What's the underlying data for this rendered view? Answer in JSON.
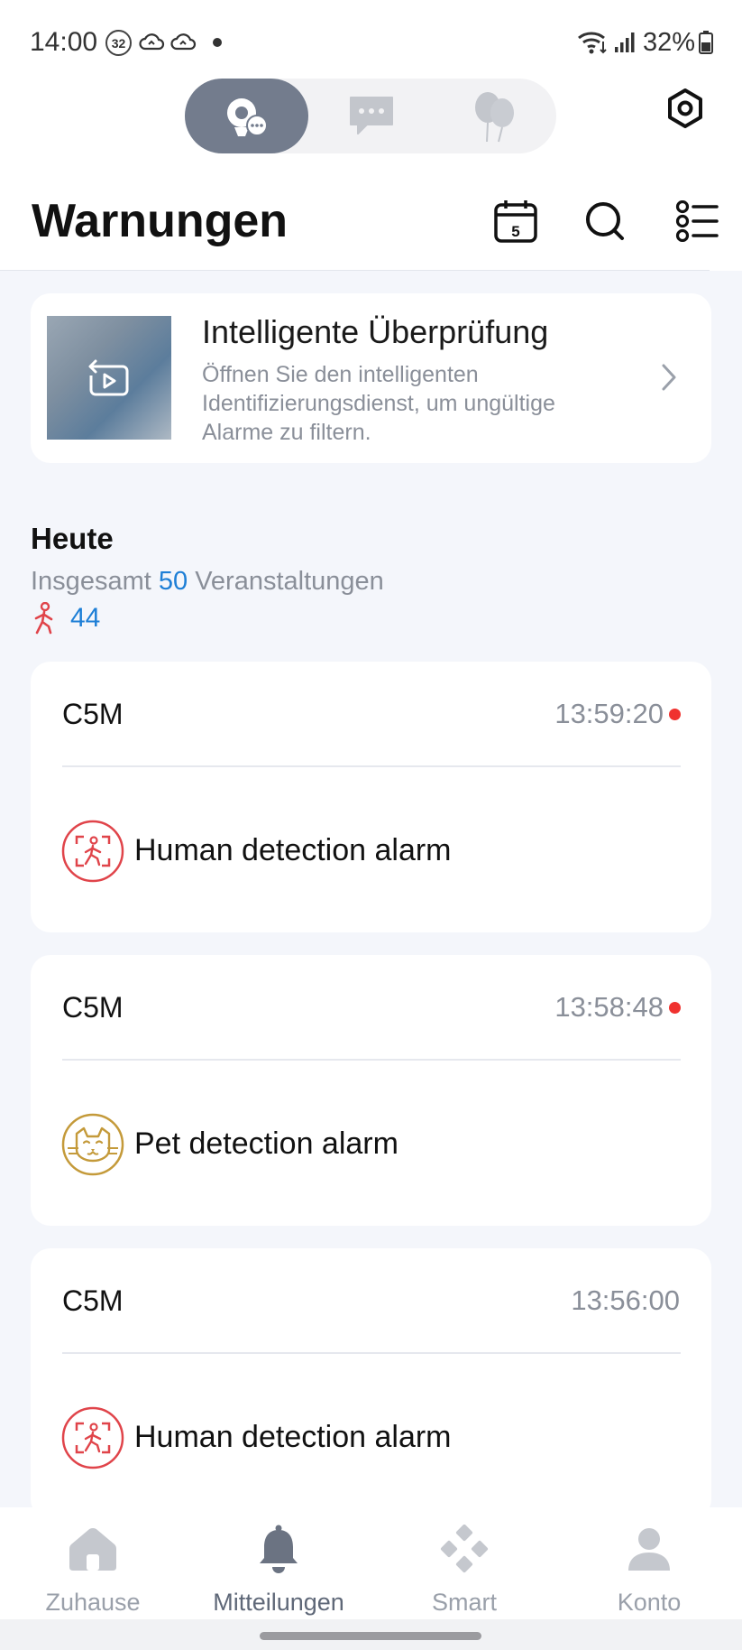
{
  "status_bar": {
    "time": "14:00",
    "notification_badge": "32",
    "battery": "32%"
  },
  "header": {
    "title": "Warnungen"
  },
  "promo": {
    "title": "Intelligente Überprüfung",
    "description": "Öffnen Sie den intelligenten Identifizierungsdienst, um ungültige Alarme zu filtern."
  },
  "today": {
    "title": "Heute",
    "summary_prefix": "Insgesamt",
    "summary_count": "50",
    "summary_suffix": "Veranstaltungen",
    "person_count": "44"
  },
  "events": [
    {
      "device": "C5M",
      "time": "13:59:20",
      "unread": true,
      "label": "Human detection alarm",
      "icon": "human-detection-icon"
    },
    {
      "device": "C5M",
      "time": "13:58:48",
      "unread": true,
      "label": "Pet detection alarm",
      "icon": "pet-detection-icon"
    },
    {
      "device": "C5M",
      "time": "13:56:00",
      "unread": false,
      "label": "Human detection alarm",
      "icon": "human-detection-icon"
    }
  ],
  "nav": {
    "items": [
      {
        "label": "Zuhause",
        "icon": "home-icon"
      },
      {
        "label": "Mitteilungen",
        "icon": "bell-icon",
        "active": true
      },
      {
        "label": "Smart",
        "icon": "smart-icon"
      },
      {
        "label": "Konto",
        "icon": "account-icon"
      }
    ]
  },
  "colors": {
    "accent_blue": "#1e7fd6",
    "alarm_red": "#e0444a",
    "pet_gold": "#c49a3a",
    "unread_dot": "#f0322f",
    "segment_active": "#737c8d"
  }
}
